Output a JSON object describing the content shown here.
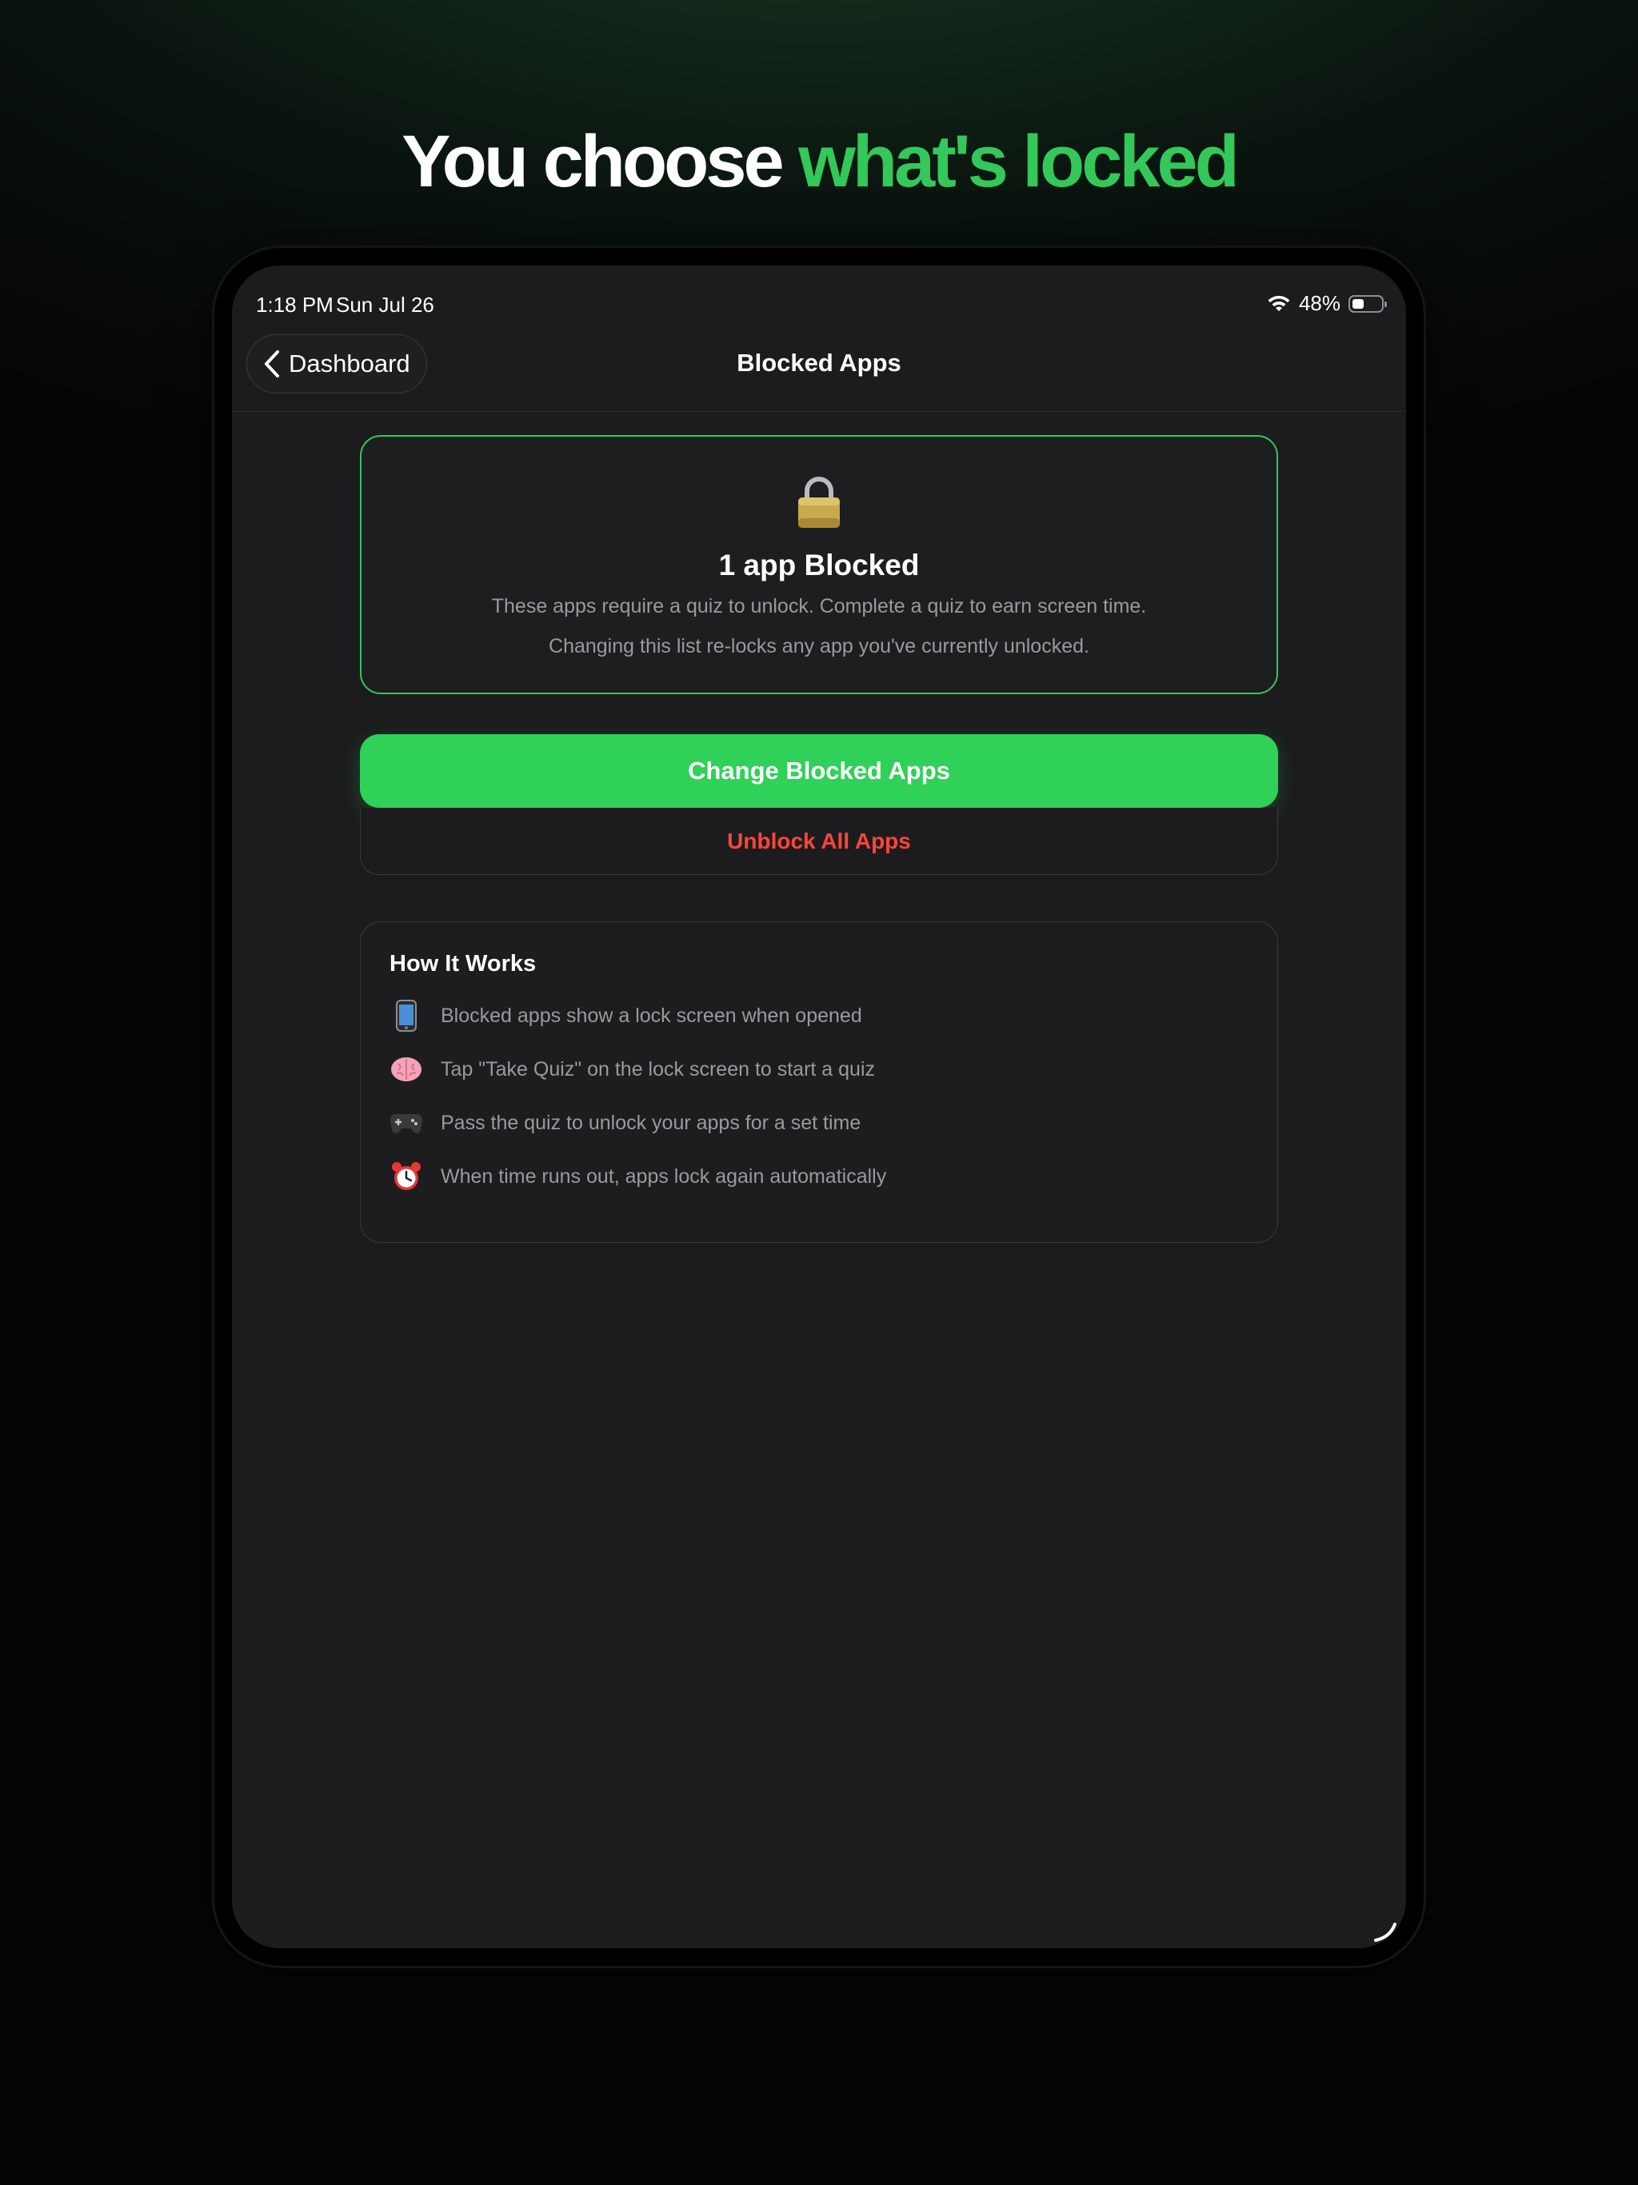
{
  "headline": {
    "part1": "You choose",
    "part2": "what's locked"
  },
  "status_bar": {
    "time": "1:18 PM",
    "date": "Sun Jul 26",
    "battery": "48%"
  },
  "nav": {
    "back_label": "Dashboard",
    "title": "Blocked Apps"
  },
  "summary": {
    "count_title": "1 app Blocked",
    "description": "These apps require a quiz to unlock. Complete a quiz to earn screen time.",
    "warning": "Changing this list re-locks any app you've currently unlocked."
  },
  "buttons": {
    "change": "Change Blocked Apps",
    "unblock": "Unblock All Apps"
  },
  "how_it_works": {
    "title": "How It Works",
    "steps": [
      {
        "icon": "phone-icon",
        "text": "Blocked apps show a lock screen when opened"
      },
      {
        "icon": "brain-icon",
        "text": "Tap \"Take Quiz\" on the lock screen to start a quiz"
      },
      {
        "icon": "gamepad-icon",
        "text": "Pass the quiz to unlock your apps for a set time"
      },
      {
        "icon": "alarm-clock-icon",
        "text": "When time runs out, apps lock again automatically"
      }
    ]
  },
  "colors": {
    "accent": "#30d158",
    "danger": "#ff453a",
    "background": "#1c1c1e"
  }
}
